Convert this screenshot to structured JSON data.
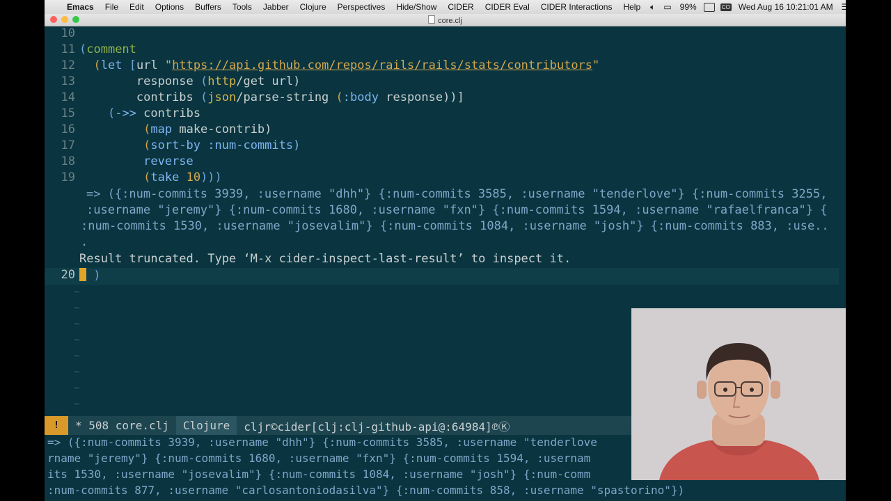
{
  "menubar": {
    "app": "Emacs",
    "items": [
      "File",
      "Edit",
      "Options",
      "Buffers",
      "Tools",
      "Jabber",
      "Clojure",
      "Perspectives",
      "Hide/Show",
      "CIDER",
      "CIDER Eval",
      "CIDER Interactions",
      "Help"
    ],
    "battery": "99%",
    "badge": "CO",
    "clock": "Wed Aug 16  10:21:01 AM"
  },
  "window": {
    "title": "core.clj"
  },
  "editor": {
    "line_numbers": [
      "10",
      "11",
      "12",
      "13",
      "14",
      "15",
      "16",
      "17",
      "18",
      "19",
      "20"
    ],
    "comment": "comment",
    "let": "let",
    "url_var": "url",
    "url": "https://api.github.com/repos/rails/rails/stats/contributors",
    "response": "response",
    "http_ns": "http",
    "get_url": "/get url)",
    "contribs": "contribs",
    "json_ns": "json",
    "parse": "/parse-string",
    "body_kw": ":body",
    "response_end": "response))]",
    "thread": "->>",
    "contribs2": "contribs",
    "map": "map",
    "make_contrib": "make-contrib)",
    "sort_by": "sort-by",
    "num_commits_kw": ":num-commits)",
    "reverse": "reverse",
    "take": "take",
    "take_n": "10",
    "take_close": ")))",
    "result_1": "=> ({:num-commits 3939, :username \"dhh\"} {:num-commits 3585, :username \"tenderlove\"} {:num-commits 3255,",
    "result_2": ":username \"jeremy\"} {:num-commits 1680, :username \"fxn\"} {:num-commits 1594, :username \"rafaelfranca\"} {",
    "result_3": ":num-commits 1530, :username \"josevalim\"} {:num-commits 1084, :username \"josh\"} {:num-commits 883, :use..",
    "result_4": ".",
    "message": "Result truncated. Type ‘M-x cider-inspect-last-result’ to inspect it.",
    "line20_close": ")",
    "tilde": "~"
  },
  "modeline": {
    "warning": "!",
    "buffer": "* 508 core.clj",
    "mode": "Clojure",
    "cider": "cljr©cider[clj:clj-github-api@:64984]℗Ⓚ"
  },
  "echo": {
    "line_1": "=> ({:num-commits 3939, :username \"dhh\"} {:num-commits 3585, :username \"tenderlove",
    "line_2": "rname \"jeremy\"} {:num-commits 1680, :username \"fxn\"} {:num-commits 1594, :usernam",
    "line_3": "its 1530, :username \"josevalim\"} {:num-commits 1084, :username \"josh\"} {:num-comm",
    "line_4": ":num-commits 877, :username \"carlosantoniodasilva\"} {:num-commits 858, :username \"spastorino\"})"
  },
  "colors": {
    "background": "#0a3540",
    "modeline": "#1d4550",
    "cursor": "#e0a429",
    "string": "#d6a84e",
    "keyword": "#7fb4f0"
  }
}
